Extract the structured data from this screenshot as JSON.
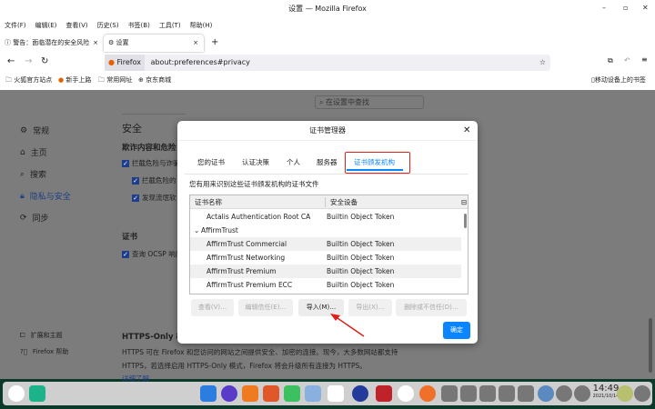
{
  "window": {
    "title": "设置 — Mozilla Firefox"
  },
  "menu": [
    "文件(F)",
    "编辑(E)",
    "查看(V)",
    "历史(S)",
    "书签(B)",
    "工具(T)",
    "帮助(H)"
  ],
  "tabs": [
    {
      "label": "警告：面临潜在的安全风险"
    },
    {
      "label": "设置"
    }
  ],
  "nav": {
    "identity": "Firefox",
    "url": "about:preferences#privacy"
  },
  "bookmarks": [
    "火狐官方站点",
    "新手上路",
    "常用网址",
    "京东商城"
  ],
  "bookmarks_right": "移动设备上的书签",
  "search": {
    "placeholder": "在设置中查找"
  },
  "sidebar": [
    {
      "label": "常规"
    },
    {
      "label": "主页"
    },
    {
      "label": "搜索"
    },
    {
      "label": "隐私与安全"
    },
    {
      "label": "同步"
    }
  ],
  "sidebar_bottom": [
    "扩展和主题",
    "Firefox 帮助"
  ],
  "main": {
    "security_heading": "安全",
    "deceptive_heading": "欺诈内容和危险",
    "cb1": "拦截危险与诈骗",
    "cb2": "拦截危险的",
    "cb3": "发现流氓软",
    "cert_heading": "证书",
    "cb4": "查询 OCSP 响应",
    "https_heading": "HTTPS-Only 模",
    "https_text1": "HTTPS 可在 Firefox 和您访问的网站之间提供安全、加密的连接。现今，大多数网站都支持",
    "https_text2": "HTTPS，若选择启用 HTTPS-Only 模式，Firefox 将会升级所有连接为 HTTPS。",
    "learn_more": "详细了解"
  },
  "dialog": {
    "title": "证书管理器",
    "tabs": [
      "您的证书",
      "认证决策",
      "个人",
      "服务器",
      "证书颁发机构"
    ],
    "description": "您有用来识别这些证书颁发机构的证书文件",
    "columns": [
      "证书名称",
      "安全设备"
    ],
    "rows": [
      {
        "name": "Actalis Authentication Root CA",
        "device": "Builtin Object Token"
      },
      {
        "name": "AffirmTrust",
        "device": "",
        "group": true
      },
      {
        "name": "AffirmTrust Commercial",
        "device": "Builtin Object Token"
      },
      {
        "name": "AffirmTrust Networking",
        "device": "Builtin Object Token"
      },
      {
        "name": "AffirmTrust Premium",
        "device": "Builtin Object Token"
      },
      {
        "name": "AffirmTrust Premium ECC",
        "device": "Builtin Object Token"
      }
    ],
    "buttons": [
      "查看(V)…",
      "编辑信任(E)…",
      "导入(M)…",
      "导出(X)…",
      "删除或不信任(D)…"
    ],
    "ok": "确定"
  },
  "clock": {
    "time": "14:49",
    "date": "2021/10/14"
  },
  "colors": {
    "accent": "#0a84ff",
    "highlight": "#e0201c"
  }
}
